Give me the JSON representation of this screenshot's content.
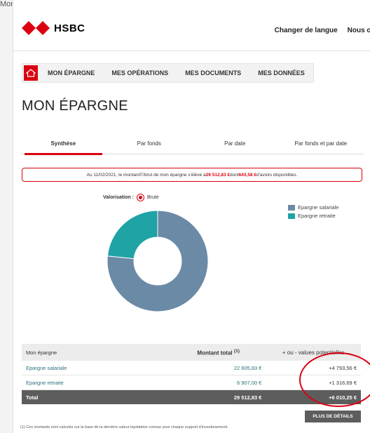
{
  "top_caption": "Mon épargne",
  "header": {
    "logo_text": "HSBC",
    "change_language": "Changer de langue",
    "contact": "Nous c"
  },
  "nav": {
    "items": [
      "MON ÉPARGNE",
      "MES OPÉRATIONS",
      "MES DOCUMENTS",
      "MES DONNÉES"
    ]
  },
  "page_title": "MON ÉPARGNE",
  "tabs": [
    "Synthèse",
    "Par fonds",
    "Par date",
    "Par fonds et par date"
  ],
  "notice": {
    "prefix": "Au 11/02/2021, le montant",
    "sup": "(1)",
    "middle": " brut de mon épargne s'élève à ",
    "amount": "29 512,83 €",
    "middle2": " dont ",
    "available": "643,58 €",
    "suffix": " d'avoirs disponibles."
  },
  "valuation": {
    "label": "Valorisation :",
    "option": "Brute"
  },
  "chart_data": {
    "type": "pie",
    "donut": true,
    "series": [
      {
        "name": "Epargne salariale",
        "value": 22605.83,
        "color": "#6b8aa6"
      },
      {
        "name": "Epargne retraite",
        "value": 6907.0,
        "color": "#1fa3a5"
      }
    ]
  },
  "table": {
    "headers": [
      "Mon épargne",
      "Montant total",
      "+ ou - values potentielles"
    ],
    "header_sup": "(1)",
    "rows": [
      {
        "label": "Epargne salariale",
        "amount": "22 605,83 €",
        "gain": "+4 793,56 €"
      },
      {
        "label": "Epargne retraite",
        "amount": "6 907,00 €",
        "gain": "+1 316,69 €"
      }
    ],
    "total": {
      "label": "Total",
      "amount": "29 512,83 €",
      "gain": "+6 010,25 €"
    }
  },
  "details_button": "PLUS DE DÉTAILS",
  "footnote": "(1) Ces montants sont calculés sur la base de la dernière valeur liquidative connue pour chaque support d'investissement.",
  "colors": {
    "brand_red": "#db0011",
    "dark_grey": "#5d5d5d"
  }
}
